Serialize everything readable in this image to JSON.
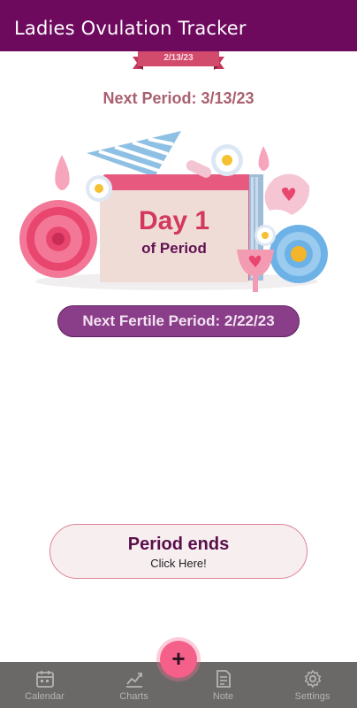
{
  "app": {
    "title": "Ladies Ovulation Tracker"
  },
  "today": {
    "date": "2/13/23"
  },
  "next_period": {
    "label": "Next Period: 3/13/23"
  },
  "day_card": {
    "day": "Day 1",
    "sub": "of Period"
  },
  "fertile": {
    "label": "Next Fertile Period: 2/22/23"
  },
  "period_ends": {
    "title": "Period ends",
    "sub": "Click Here!"
  },
  "fab": {
    "label": "+"
  },
  "nav": {
    "items": [
      {
        "label": "Calendar",
        "icon": "calendar-icon"
      },
      {
        "label": "Charts",
        "icon": "chart-icon"
      },
      {
        "label": "Note",
        "icon": "note-icon"
      },
      {
        "label": "Settings",
        "icon": "gear-icon"
      }
    ]
  },
  "colors": {
    "app_bar": "#6e0a5e",
    "accent_pink": "#f5608a",
    "fertile_pill": "#8a3d89",
    "nav_bg": "#6b6967"
  }
}
